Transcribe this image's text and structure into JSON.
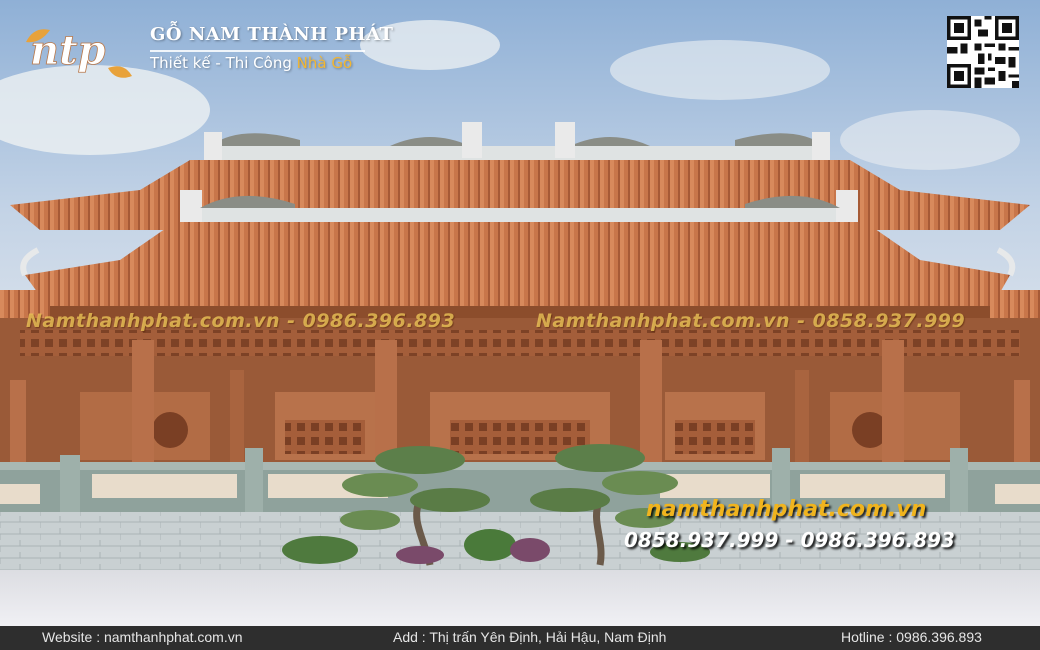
{
  "brand": {
    "name": "GỖ NAM THÀNH PHÁT",
    "tagline_prefix": "Thiết kế - Thi Công ",
    "tagline_highlight": "Nhà Gỗ",
    "logo_text": "ntp"
  },
  "watermarks": [
    "Namthanhphat.com.vn - 0986.396.893",
    "Namthanhphat.com.vn - 0858.937.999"
  ],
  "promo": {
    "website": "namthanhphat.com.vn",
    "phones": "0858.937.999 - 0986.396.893"
  },
  "footer": {
    "website": "Website : namthanhphat.com.vn",
    "address": "Add : Thị trấn Yên Định, Hải Hậu, Nam Định",
    "hotline": "Hotline : 0986.396.893"
  },
  "colors": {
    "roof_tile": "#c8764a",
    "wood": "#b8704a",
    "stone": "#8fa29c",
    "brand_accent": "#f2b632",
    "sky": "#b9cde3"
  }
}
